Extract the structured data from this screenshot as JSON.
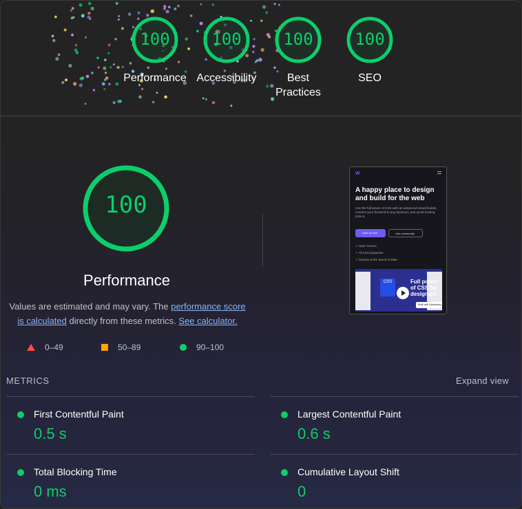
{
  "top_gauges": [
    {
      "score": "100",
      "label": "Performance"
    },
    {
      "score": "100",
      "label": "Accessibility"
    },
    {
      "score": "100",
      "label": "Best Practices"
    },
    {
      "score": "100",
      "label": "SEO"
    }
  ],
  "performance": {
    "score": "100",
    "title": "Performance",
    "desc_prefix": "Values are estimated and may vary. The ",
    "link_score": "performance score is calculated",
    "desc_middle": " directly from these metrics. ",
    "link_calc": "See calculator."
  },
  "legend": [
    {
      "range": "0–49",
      "shape": "triangle",
      "color": "#ff4e42"
    },
    {
      "range": "50–89",
      "shape": "square",
      "color": "#ffa400"
    },
    {
      "range": "90–100",
      "shape": "circle",
      "color": "#0cce6b"
    }
  ],
  "screenshot": {
    "heading": "A happy place to design and build for the web",
    "sub": "Use the full power of CSS with an advanced visual builder, connect your frontend to any backend, and avoid hosting lock-in.",
    "btn_primary": "Start for free",
    "btn_secondary": "Join community",
    "checks": [
      "Open Source",
      "All CSS properties",
      "Canvas at the speed of state"
    ],
    "video_text": "Full power of CSS for designers",
    "video_badge": "CSS",
    "built_badge": "Built with Webstudio"
  },
  "metrics": {
    "label": "METRICS",
    "expand": "Expand view",
    "items": [
      {
        "name": "First Contentful Paint",
        "value": "0.5 s"
      },
      {
        "name": "Largest Contentful Paint",
        "value": "0.6 s"
      },
      {
        "name": "Total Blocking Time",
        "value": "0 ms"
      },
      {
        "name": "Cumulative Layout Shift",
        "value": "0"
      }
    ]
  },
  "colors": {
    "pass": "#0cce6b",
    "average": "#ffa400",
    "fail": "#ff4e42",
    "link": "#8ab4f8"
  }
}
